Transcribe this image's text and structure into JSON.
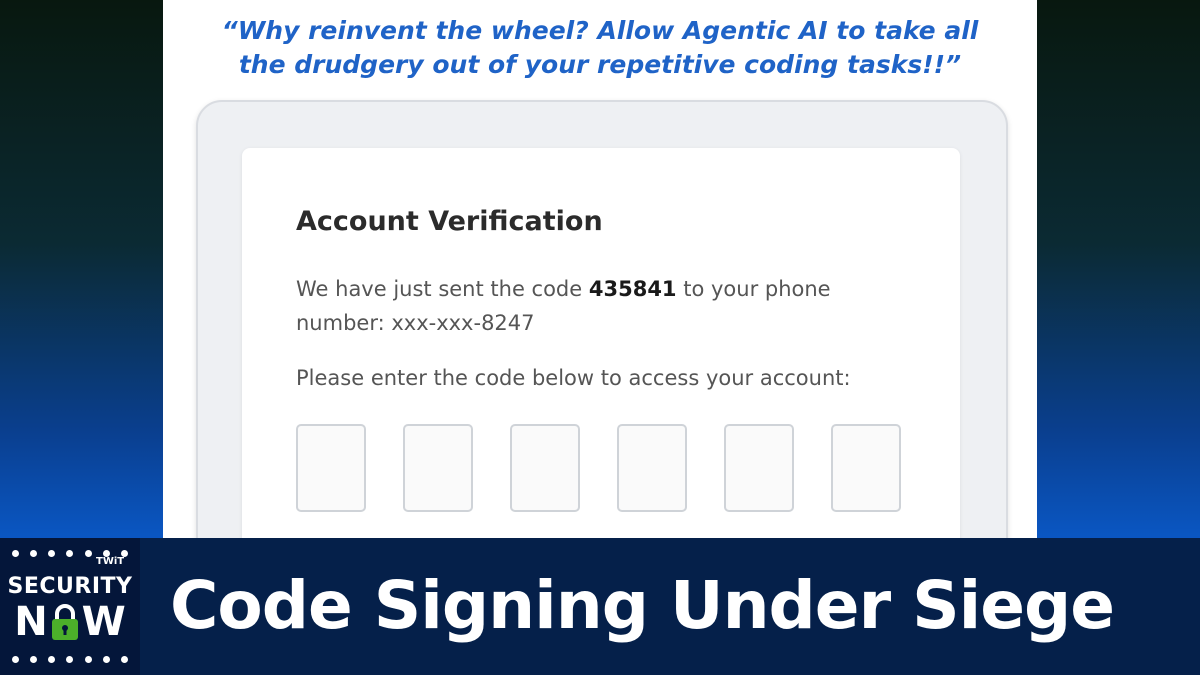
{
  "quote": {
    "line1": "“Why reinvent the wheel? Allow Agentic AI to take all",
    "line2": "the drudgery out of your repetitive coding tasks!!”"
  },
  "verification": {
    "title": "Account Verification",
    "message_before": "We have just sent the code ",
    "code": "435841",
    "message_after": " to your phone number: xxx-xxx-8247",
    "instruction": "Please enter the code below to access your account:",
    "code_inputs": [
      "",
      "",
      "",
      "",
      "",
      ""
    ]
  },
  "logo": {
    "network": "TWiT",
    "line1": "SECURITY",
    "now_left": "N",
    "now_right": "W",
    "lock_color": "#4caf2a"
  },
  "episode": {
    "title": "Code Signing Under Siege"
  },
  "colors": {
    "quote_text": "#1f63c7",
    "bar_background": "#05204a"
  }
}
